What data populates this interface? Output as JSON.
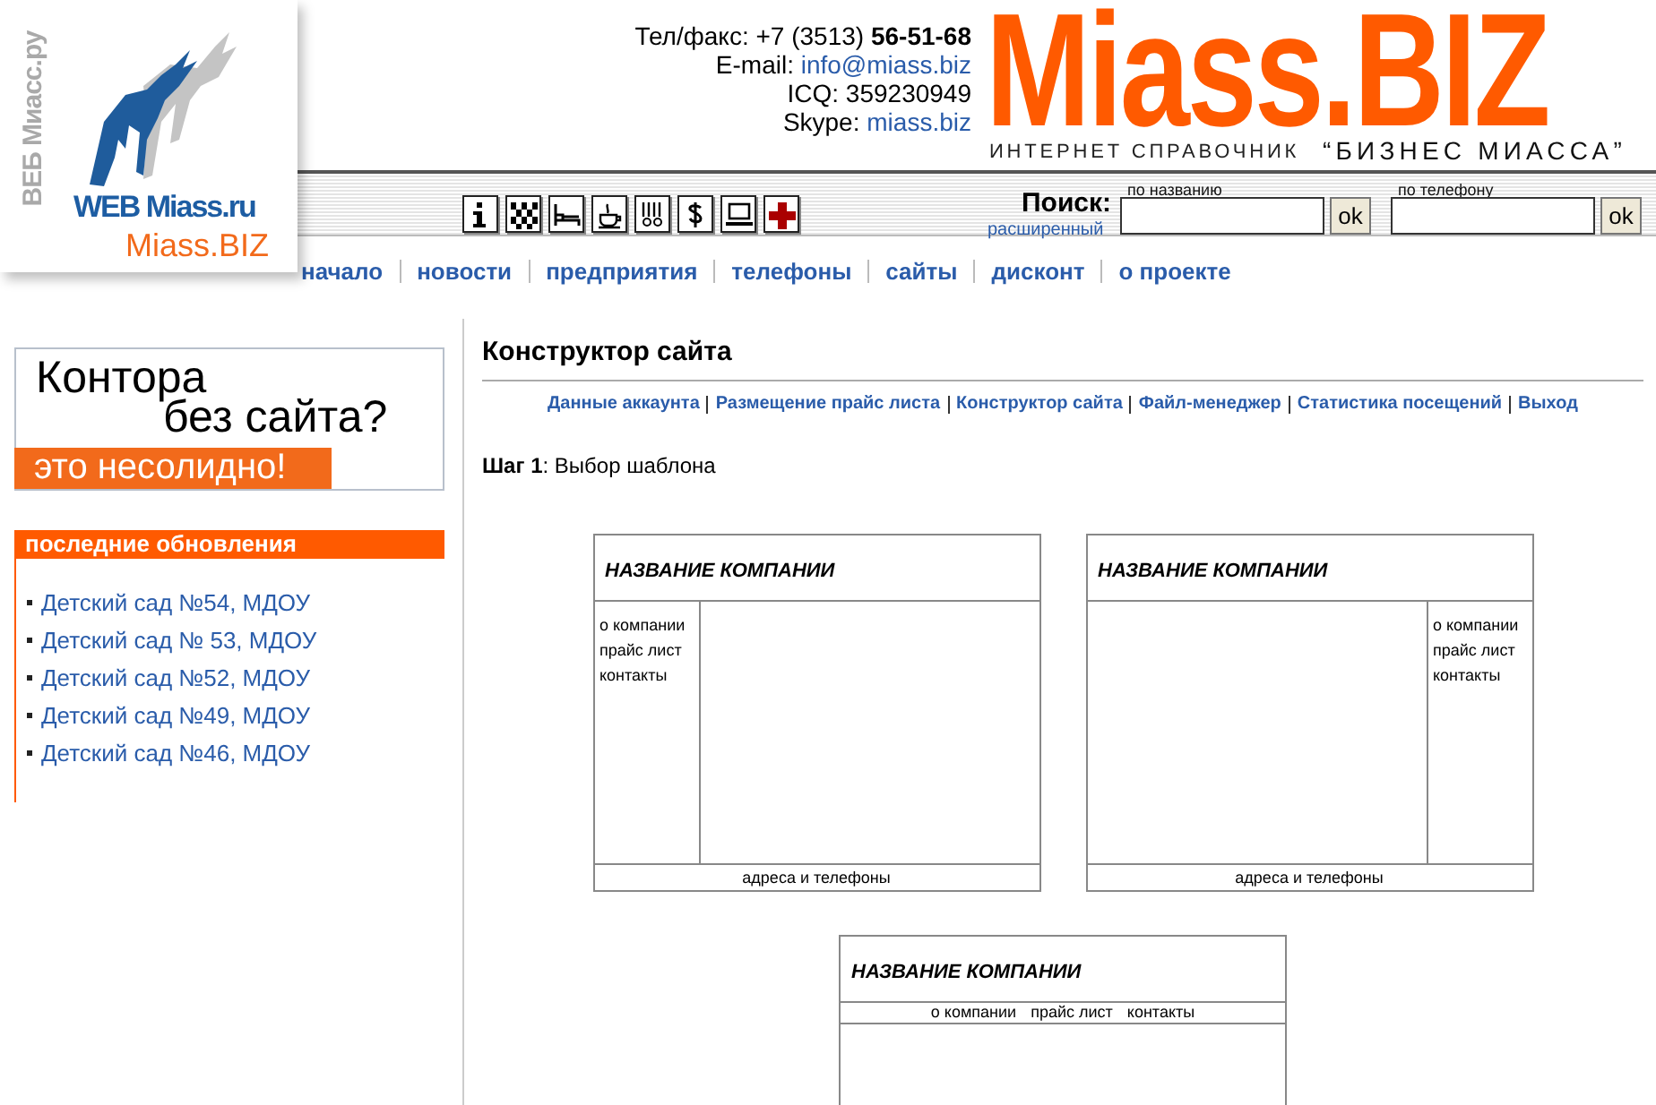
{
  "logo": {
    "vertical_text": "ВЕБ Миасс.ру",
    "site": "WEB Miass.ru",
    "brand": "Miass.BIZ"
  },
  "contacts": {
    "phone": "Тел/факс: +7 (3513) **56-51-68**",
    "email_label": "E-mail: ",
    "email": "info@miass.biz",
    "icq": "ICQ: 359230949",
    "skype_label": "Skype: ",
    "skype": "miass.biz"
  },
  "masthead": {
    "title": "Miass.BIZ",
    "subtitle": "ИНТЕРНЕТ СПРАВОЧНИК",
    "slogan": "“БИЗНЕС МИАССА”"
  },
  "search": {
    "label": "Поиск:",
    "advanced_link": "расширенный",
    "fields": [
      {
        "label": "по названию",
        "button": "ok"
      },
      {
        "label": "по телефону",
        "button": "ok"
      }
    ]
  },
  "nav": [
    "начало",
    "новости",
    "предприятия",
    "телефоны",
    "сайты",
    "дисконт",
    "о проекте"
  ],
  "banner": {
    "line_1": "Контора",
    "line_2": "без сайта?",
    "tagline": "это несолидно!"
  },
  "updates": {
    "title": "последние обновления",
    "items": [
      "Детский сад №54, МДОУ",
      "Детский сад № 53, МДОУ",
      "Детский сад №52, МДОУ",
      "Детский сад №49, МДОУ",
      "Детский сад №46, МДОУ"
    ]
  },
  "page": {
    "title": "Конструктор сайта",
    "links": [
      "Данные аккаунта",
      "Размещение прайс листа",
      "Конструктор сайта",
      "Файл-менеджер",
      "Статистика посещений",
      "Выход"
    ],
    "step": "**Шаг 1**: Выбор шаблона"
  },
  "templates": [
    {
      "kind": "left-menu",
      "title": "НАЗВАНИЕ КОМПАНИИ",
      "menu": [
        "о компании",
        "прайс лист",
        "контакты"
      ],
      "footer": "адреса и телефоны"
    },
    {
      "kind": "right-menu",
      "title": "НАЗВАНИЕ КОМПАНИИ",
      "menu": [
        "о компании",
        "прайс лист",
        "контакты"
      ],
      "footer": "адреса и телефоны"
    },
    {
      "kind": "top-menu",
      "title": "НАЗВАНИЕ КОМПАНИИ",
      "menu": [
        "о компании",
        "прайс лист",
        "контакты"
      ]
    }
  ]
}
